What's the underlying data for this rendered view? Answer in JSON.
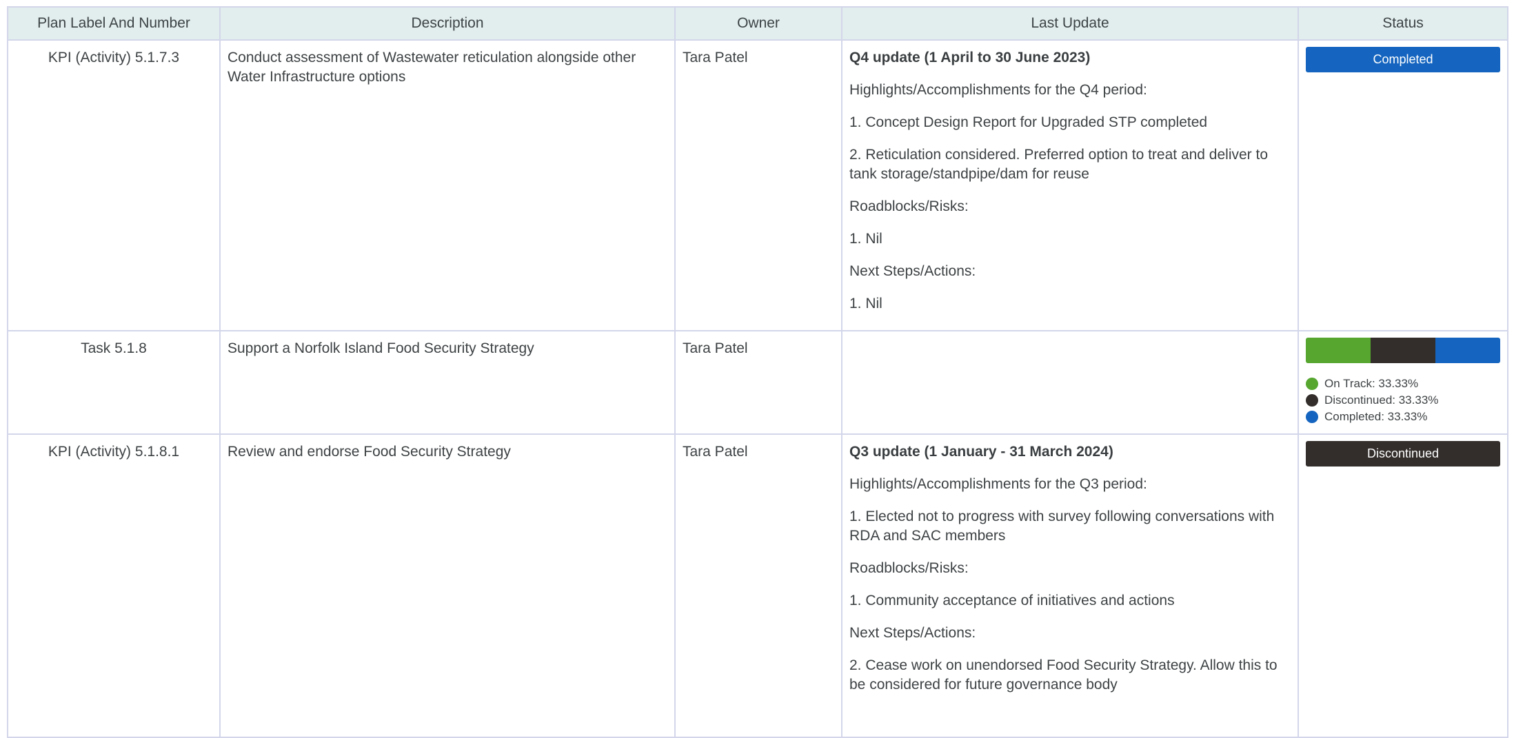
{
  "headers": [
    "Plan Label And Number",
    "Description",
    "Owner",
    "Last Update",
    "Status"
  ],
  "colors": {
    "completed": "#1565c0",
    "discontinued": "#332e2c",
    "on_track": "#56a630"
  },
  "rows": [
    {
      "plan": "KPI (Activity) 5.1.7.3",
      "description": "Conduct assessment of Wastewater reticulation alongside other Water Infrastructure options",
      "owner": "Tara Patel",
      "update_title": "Q4 update (1 April to 30 June 2023)",
      "update_lines": [
        "Highlights/Accomplishments for the Q4 period:",
        "1. Concept Design Report for Upgraded STP completed",
        "2. Reticulation considered. Preferred option to treat and deliver to tank storage/standpipe/dam for reuse",
        "Roadblocks/Risks:",
        "1.  Nil",
        "Next Steps/Actions:",
        "1. Nil"
      ],
      "status": "Completed"
    },
    {
      "plan": "Task 5.1.8",
      "description": "Support a Norfolk Island Food Security Strategy",
      "owner": "Tara Patel",
      "status_bar": [
        {
          "label": "On Track: 33.33%",
          "fraction": 0.3333,
          "color": "#56a630"
        },
        {
          "label": "Discontinued: 33.33%",
          "fraction": 0.3333,
          "color": "#332e2c"
        },
        {
          "label": "Completed: 33.33%",
          "fraction": 0.3334,
          "color": "#1565c0"
        }
      ]
    },
    {
      "plan": "KPI (Activity) 5.1.8.1",
      "description": "Review and endorse Food Security Strategy",
      "owner": "Tara Patel",
      "update_title": "Q3 update (1 January - 31 March 2024)",
      "update_lines": [
        "Highlights/Accomplishments for the Q3 period:",
        "1. Elected not to progress with survey following conversations with RDA and SAC members",
        "Roadblocks/Risks:",
        "1.  Community acceptance of initiatives and actions",
        "Next Steps/Actions:",
        "2. Cease work on unendorsed Food Security Strategy. Allow this to be considered for future governance body"
      ],
      "status": "Discontinued"
    }
  ]
}
